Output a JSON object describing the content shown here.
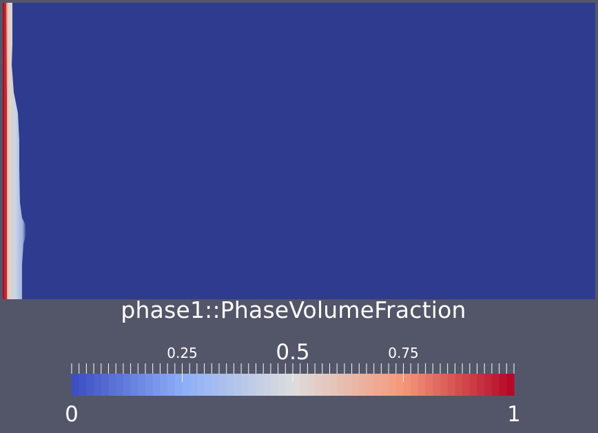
{
  "scalar_bar": {
    "title": "phase1::PhaseVolumeFraction",
    "range": [
      0,
      1
    ],
    "labels": [
      {
        "value": 0.25,
        "text": "0.25",
        "size": "small"
      },
      {
        "value": 0.5,
        "text": "0.5",
        "size": "mid"
      },
      {
        "value": 0.75,
        "text": "0.75",
        "size": "small"
      },
      {
        "value": 0,
        "text": "0",
        "size": "end"
      },
      {
        "value": 1,
        "text": "1",
        "size": "end"
      }
    ],
    "colormap": [
      "#3b4cc0",
      "#8caef8",
      "#dddddd",
      "#f4987a",
      "#b40426"
    ],
    "segments": 60,
    "minor_ticks": 60
  },
  "colors": {
    "background": "#535669",
    "field_low": "#2e3b8e",
    "field_high": "#b40426"
  }
}
